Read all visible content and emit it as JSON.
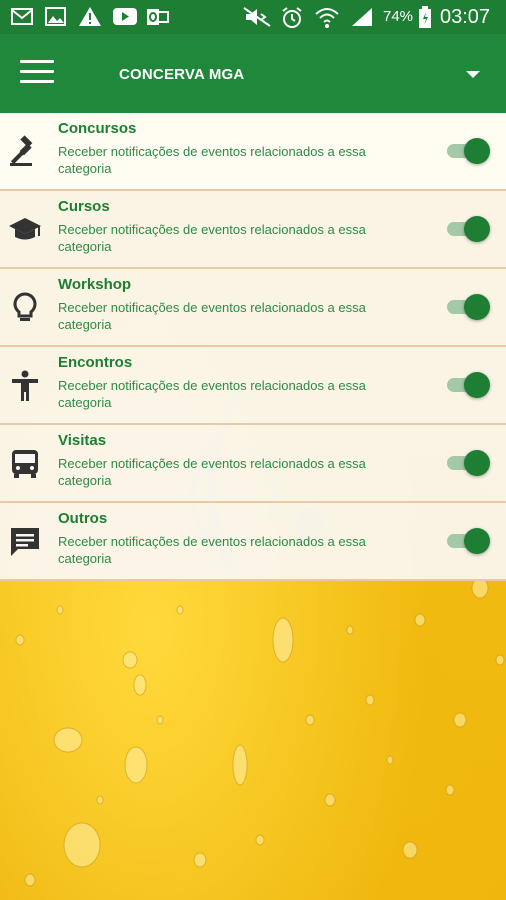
{
  "status_bar": {
    "icons": [
      "gmail-icon",
      "gallery-icon",
      "warning-icon",
      "youtube-icon",
      "outlook-icon",
      "mute-icon",
      "alarm-icon",
      "wifi-icon",
      "signal-icon",
      "battery-icon"
    ],
    "battery": "74%",
    "time": "03:07"
  },
  "app_bar": {
    "menu_icon": "hamburger-menu-icon",
    "title": "CONCERVA MGA",
    "dropdown_icon": "dropdown-arrow-icon"
  },
  "categories": [
    {
      "title": "Concursos",
      "description": "Receber notificações de eventos relacionados a essa categoria",
      "icon": "gavel-icon",
      "enabled": true
    },
    {
      "title": "Cursos",
      "description": "Receber notificações de eventos relacionados a essa categoria",
      "icon": "graduation-cap-icon",
      "enabled": true
    },
    {
      "title": "Workshop",
      "description": "Receber notificações de eventos relacionados a essa categoria",
      "icon": "lightbulb-icon",
      "enabled": true
    },
    {
      "title": "Encontros",
      "description": "Receber notificações de eventos relacionados a essa categoria",
      "icon": "person-icon",
      "enabled": true
    },
    {
      "title": "Visitas",
      "description": "Receber notificações de eventos relacionados a essa categoria",
      "icon": "bus-icon",
      "enabled": true
    },
    {
      "title": "Outros",
      "description": "Receber notificações de eventos relacionados a essa categoria",
      "icon": "chat-bubble-icon",
      "enabled": true
    }
  ],
  "colors": {
    "primary": "#20883b",
    "status_bar": "#1e7e34",
    "toggle_on": "#1e7e34",
    "background": "#f3c51b"
  }
}
